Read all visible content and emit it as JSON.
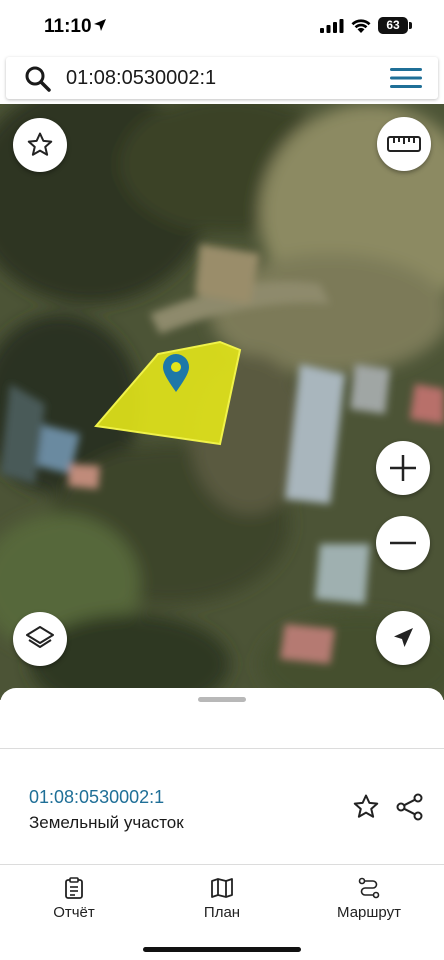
{
  "status_bar": {
    "time": "11:10",
    "battery": "63"
  },
  "search": {
    "query": "01:08:0530002:1",
    "icon": "search-icon",
    "menu_icon": "hamburger-menu-icon"
  },
  "map": {
    "type": "satellite",
    "parcel_fill": "#e3e51a",
    "marker_color": "#1d78a8",
    "buttons": {
      "favorite": "star-icon",
      "ruler": "ruler-icon",
      "zoom_in": "plus-icon",
      "zoom_out": "minus-icon",
      "layers": "layers-icon",
      "locate": "navigation-arrow-icon"
    }
  },
  "sheet": {
    "cadastral_number": "01:08:0530002:1",
    "object_type": "Земельный участок",
    "accent_color": "#1f6f97"
  },
  "nav": {
    "items": [
      {
        "label": "Отчёт",
        "icon": "report-clipboard-icon"
      },
      {
        "label": "План",
        "icon": "map-plan-icon"
      },
      {
        "label": "Маршрут",
        "icon": "route-icon"
      }
    ]
  }
}
